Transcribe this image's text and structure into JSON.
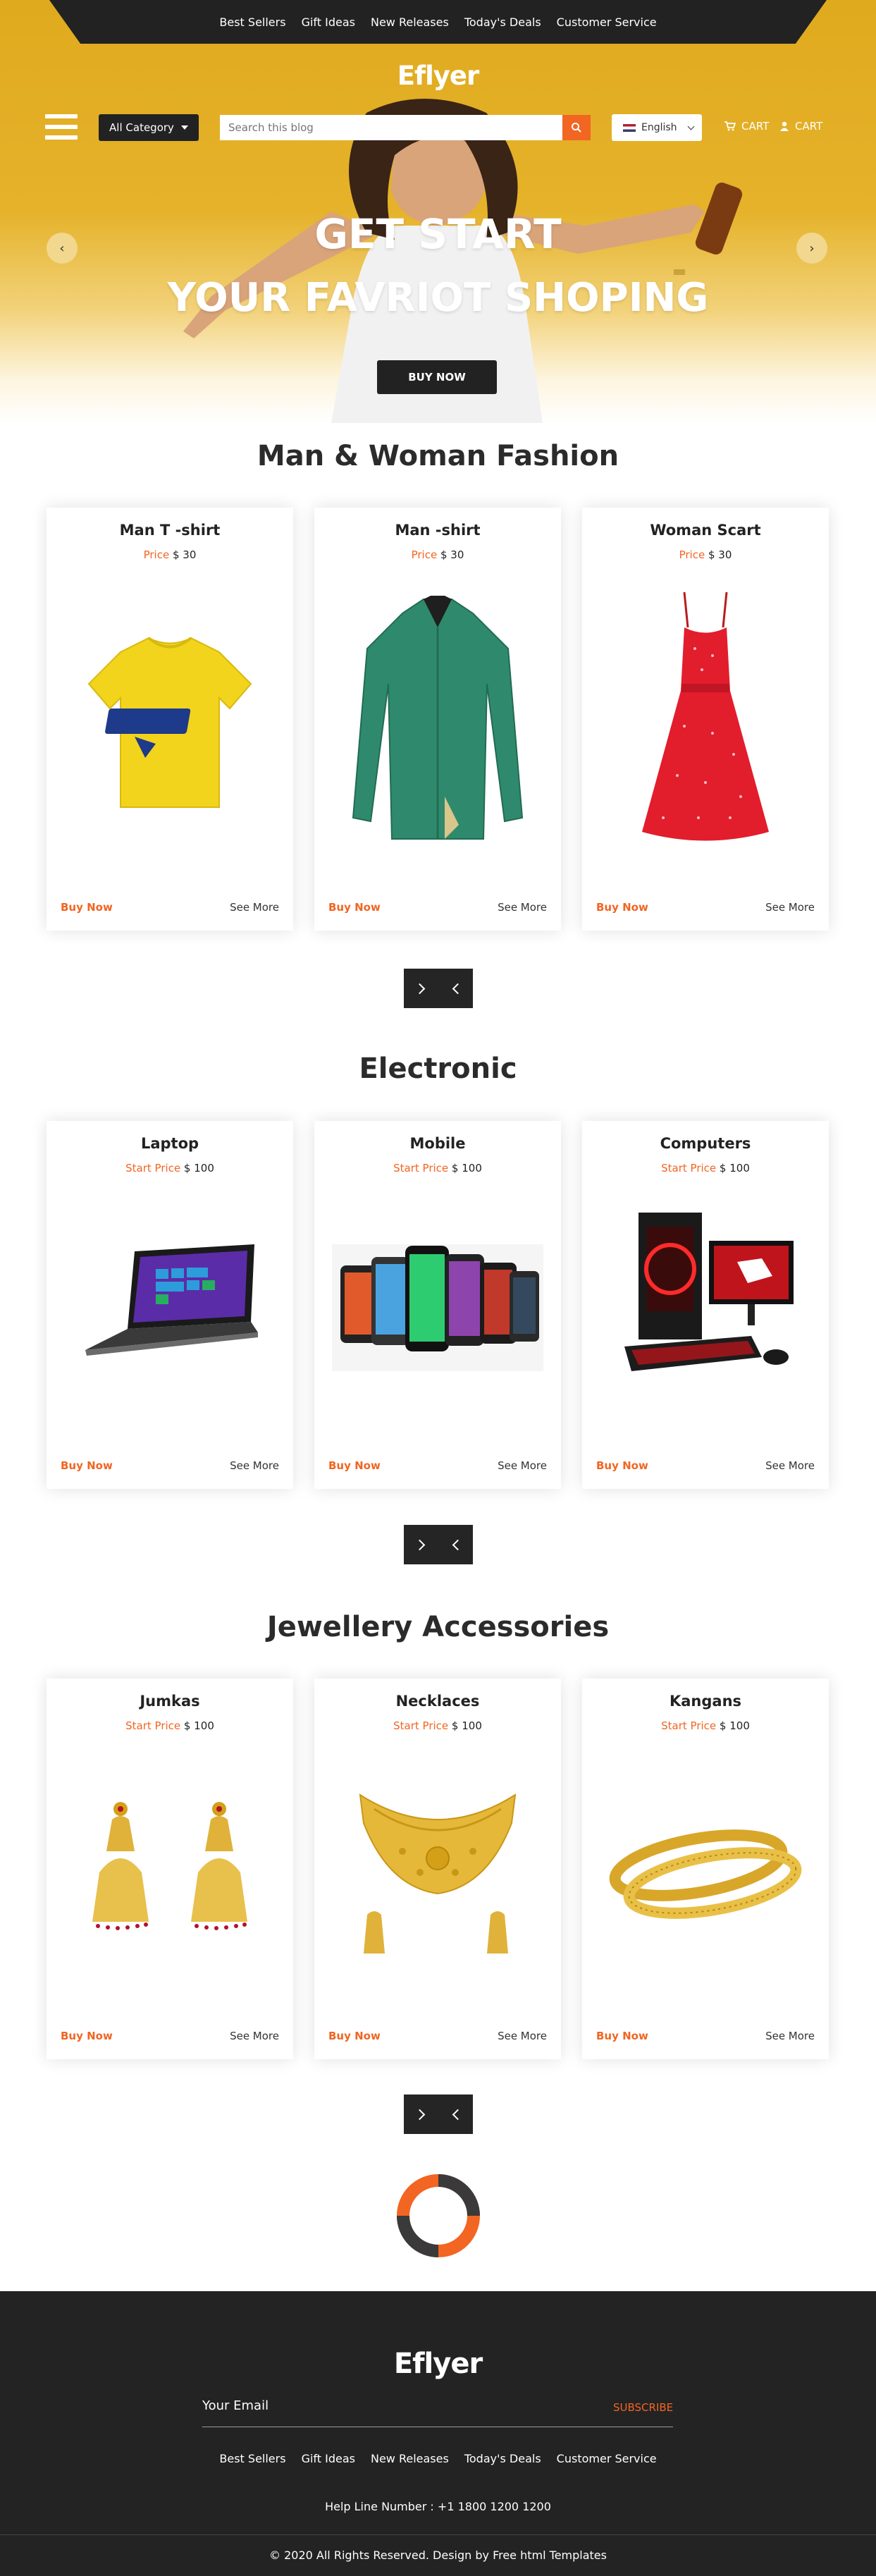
{
  "topnav": {
    "items": [
      "Best Sellers",
      "Gift Ideas",
      "New Releases",
      "Today's Deals",
      "Customer Service"
    ]
  },
  "logo": "Eflyer",
  "header": {
    "category_label": "All Category",
    "search_placeholder": "Search this blog",
    "language": "English",
    "cart_label": "CART",
    "account_label": "CART"
  },
  "hero": {
    "line1": "GET START",
    "line2": "YOUR FAVRIOT SHOPING",
    "button": "BUY NOW",
    "prev_arrow": "‹",
    "next_arrow": "›"
  },
  "sections": [
    {
      "title": "Man & Woman Fashion",
      "price_label": "Price",
      "products": [
        {
          "name": "Man T -shirt",
          "price": "$ 30"
        },
        {
          "name": "Man -shirt",
          "price": "$ 30"
        },
        {
          "name": "Woman Scart",
          "price": "$ 30"
        }
      ]
    },
    {
      "title": "Electronic",
      "price_label": "Start Price",
      "products": [
        {
          "name": "Laptop",
          "price": "$ 100"
        },
        {
          "name": "Mobile",
          "price": "$ 100"
        },
        {
          "name": "Computers",
          "price": "$ 100"
        }
      ]
    },
    {
      "title": "Jewellery Accessories",
      "price_label": "Start Price",
      "products": [
        {
          "name": "Jumkas",
          "price": "$ 100"
        },
        {
          "name": "Necklaces",
          "price": "$ 100"
        },
        {
          "name": "Kangans",
          "price": "$ 100"
        }
      ]
    }
  ],
  "card_actions": {
    "buy": "Buy Now",
    "more": "See More"
  },
  "footer": {
    "logo": "Eflyer",
    "email_label": "Your Email",
    "subscribe": "SUBSCRIBE",
    "links": [
      "Best Sellers",
      "Gift Ideas",
      "New Releases",
      "Today's Deals",
      "Customer Service"
    ],
    "helpline": "Help Line Number : +1 1800 1200 1200",
    "copyright": "© 2020 All Rights Reserved. Design by Free html Templates"
  },
  "colors": {
    "accent": "#f26522",
    "dark": "#222222",
    "hero_yellow": "#e3ad24"
  }
}
